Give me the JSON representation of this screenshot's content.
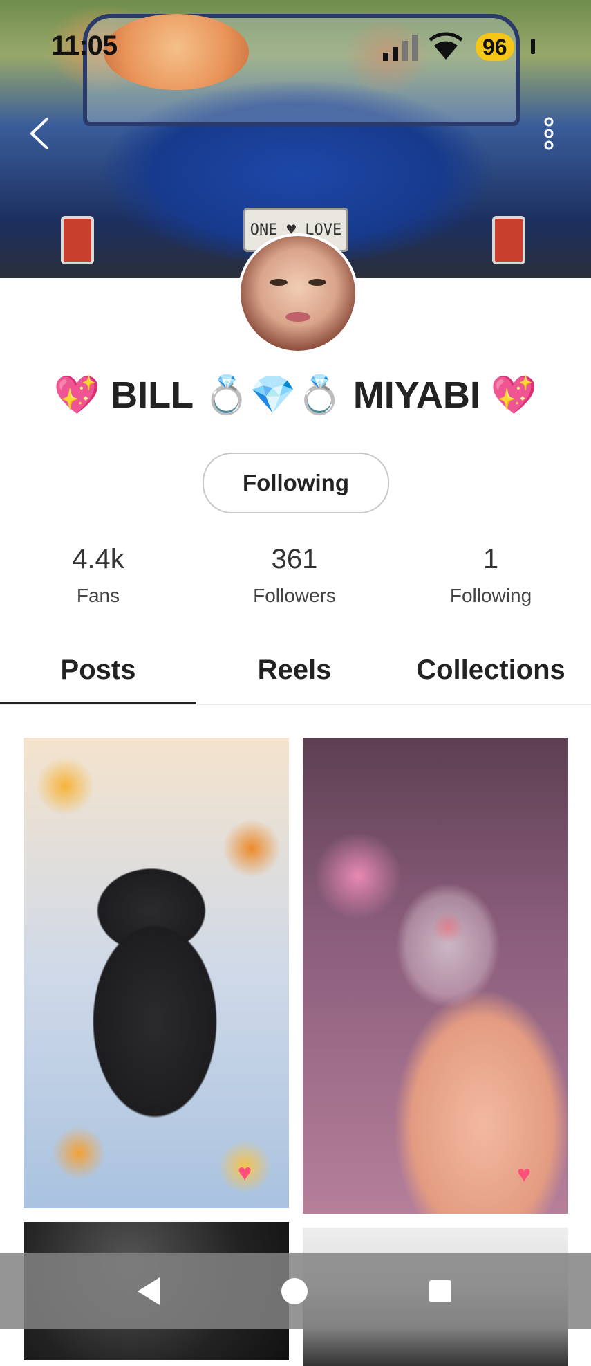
{
  "status_bar": {
    "time": "11:05",
    "battery": "96"
  },
  "cover": {
    "plate_text": "ONE ♥ LOVE"
  },
  "profile": {
    "name": "💖 BILL 💍💎💍 MIYABI 💖",
    "follow_button": "Following"
  },
  "stats": [
    {
      "value": "4.4k",
      "label": "Fans"
    },
    {
      "value": "361",
      "label": "Followers"
    },
    {
      "value": "1",
      "label": "Following"
    }
  ],
  "tabs": [
    {
      "label": "Posts",
      "active": true
    },
    {
      "label": "Reels",
      "active": false
    },
    {
      "label": "Collections",
      "active": false
    }
  ],
  "icons": {
    "back": "chevron-left-icon",
    "more": "more-vertical-icon",
    "nav_back": "triangle-back-icon",
    "nav_home": "circle-home-icon",
    "nav_recent": "square-recents-icon"
  },
  "colors": {
    "battery": "#f5c518",
    "heart": "#ff4f7a"
  }
}
